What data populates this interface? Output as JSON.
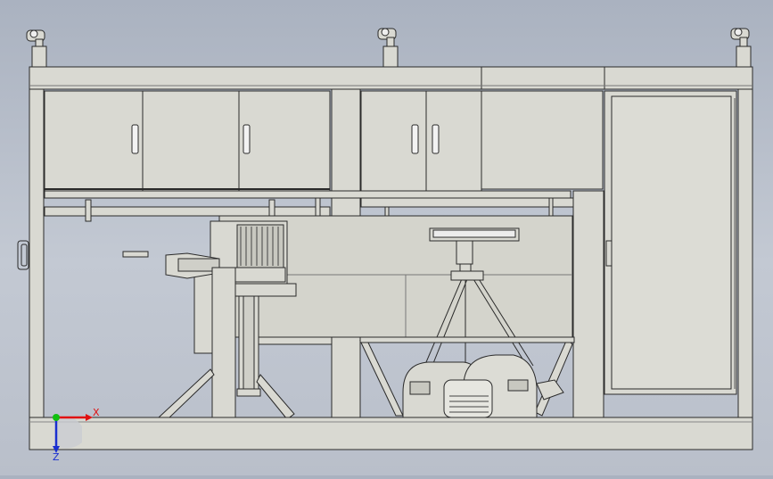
{
  "viewport": {
    "background_top": "#aab2c0",
    "background_bottom": "#b9bfca",
    "part_fill": "#d9d9d2",
    "edge_color": "#2a2a2a"
  },
  "triad": {
    "x_label": "X",
    "z_label": "Z",
    "x_color": "#e01010",
    "y_color": "#10c010",
    "z_color": "#1a2fd0"
  }
}
